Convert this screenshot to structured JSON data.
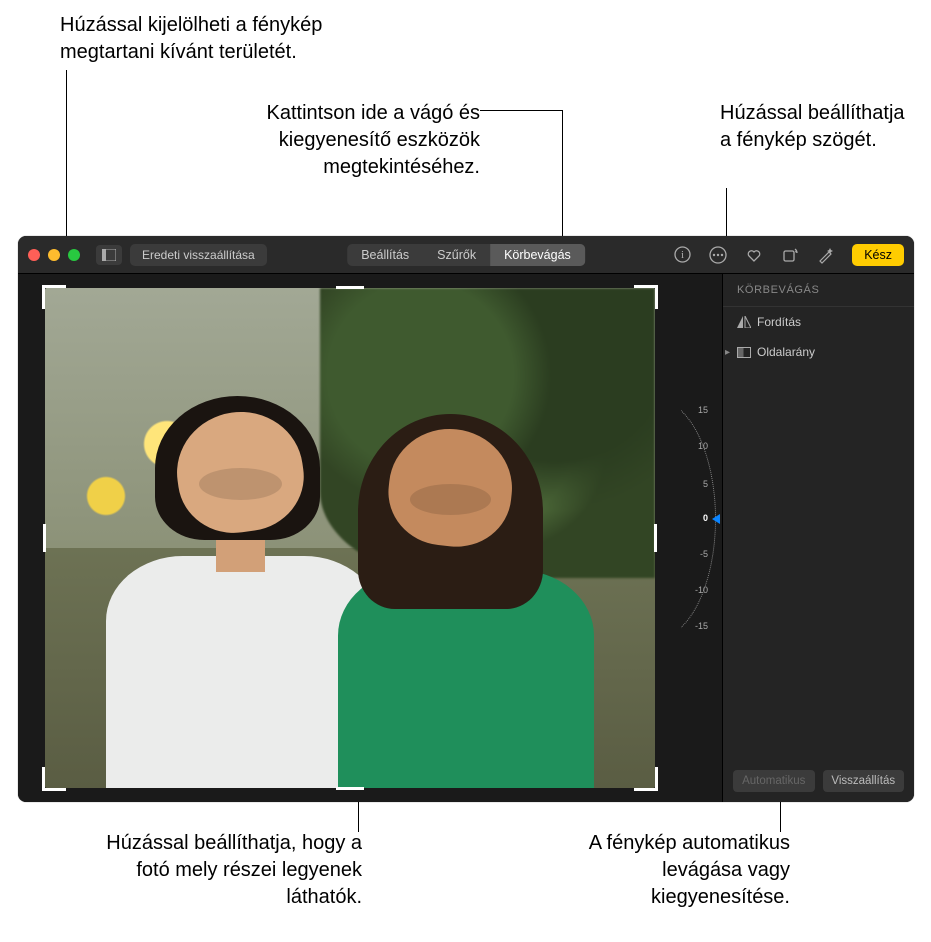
{
  "callouts": {
    "top_left": "Húzással kijelölheti a fénykép megtartani kívánt területét.",
    "top_mid": "Kattintson ide a vágó és kiegyenesítő eszközök megtekintéséhez.",
    "top_right": "Húzással beállíthatja a fénykép szögét.",
    "bottom_left": "Húzással beállíthatja, hogy a fotó mely részei legyenek láthatók.",
    "bottom_right": "A fénykép automatikus levágása vagy kiegyenesítése."
  },
  "toolbar": {
    "revert_label": "Eredeti visszaállítása",
    "tabs": {
      "adjust": "Beállítás",
      "filters": "Szűrők",
      "crop": "Körbevágás"
    },
    "done_label": "Kész"
  },
  "sidebar": {
    "header": "KÖRBEVÁGÁS",
    "flip_label": "Fordítás",
    "aspect_label": "Oldalarány",
    "auto_label": "Automatikus",
    "reset_label": "Visszaállítás"
  },
  "angle_dial": {
    "ticks": [
      "15",
      "10",
      "5",
      "0",
      "-5",
      "-10",
      "-15"
    ],
    "value": "0"
  }
}
